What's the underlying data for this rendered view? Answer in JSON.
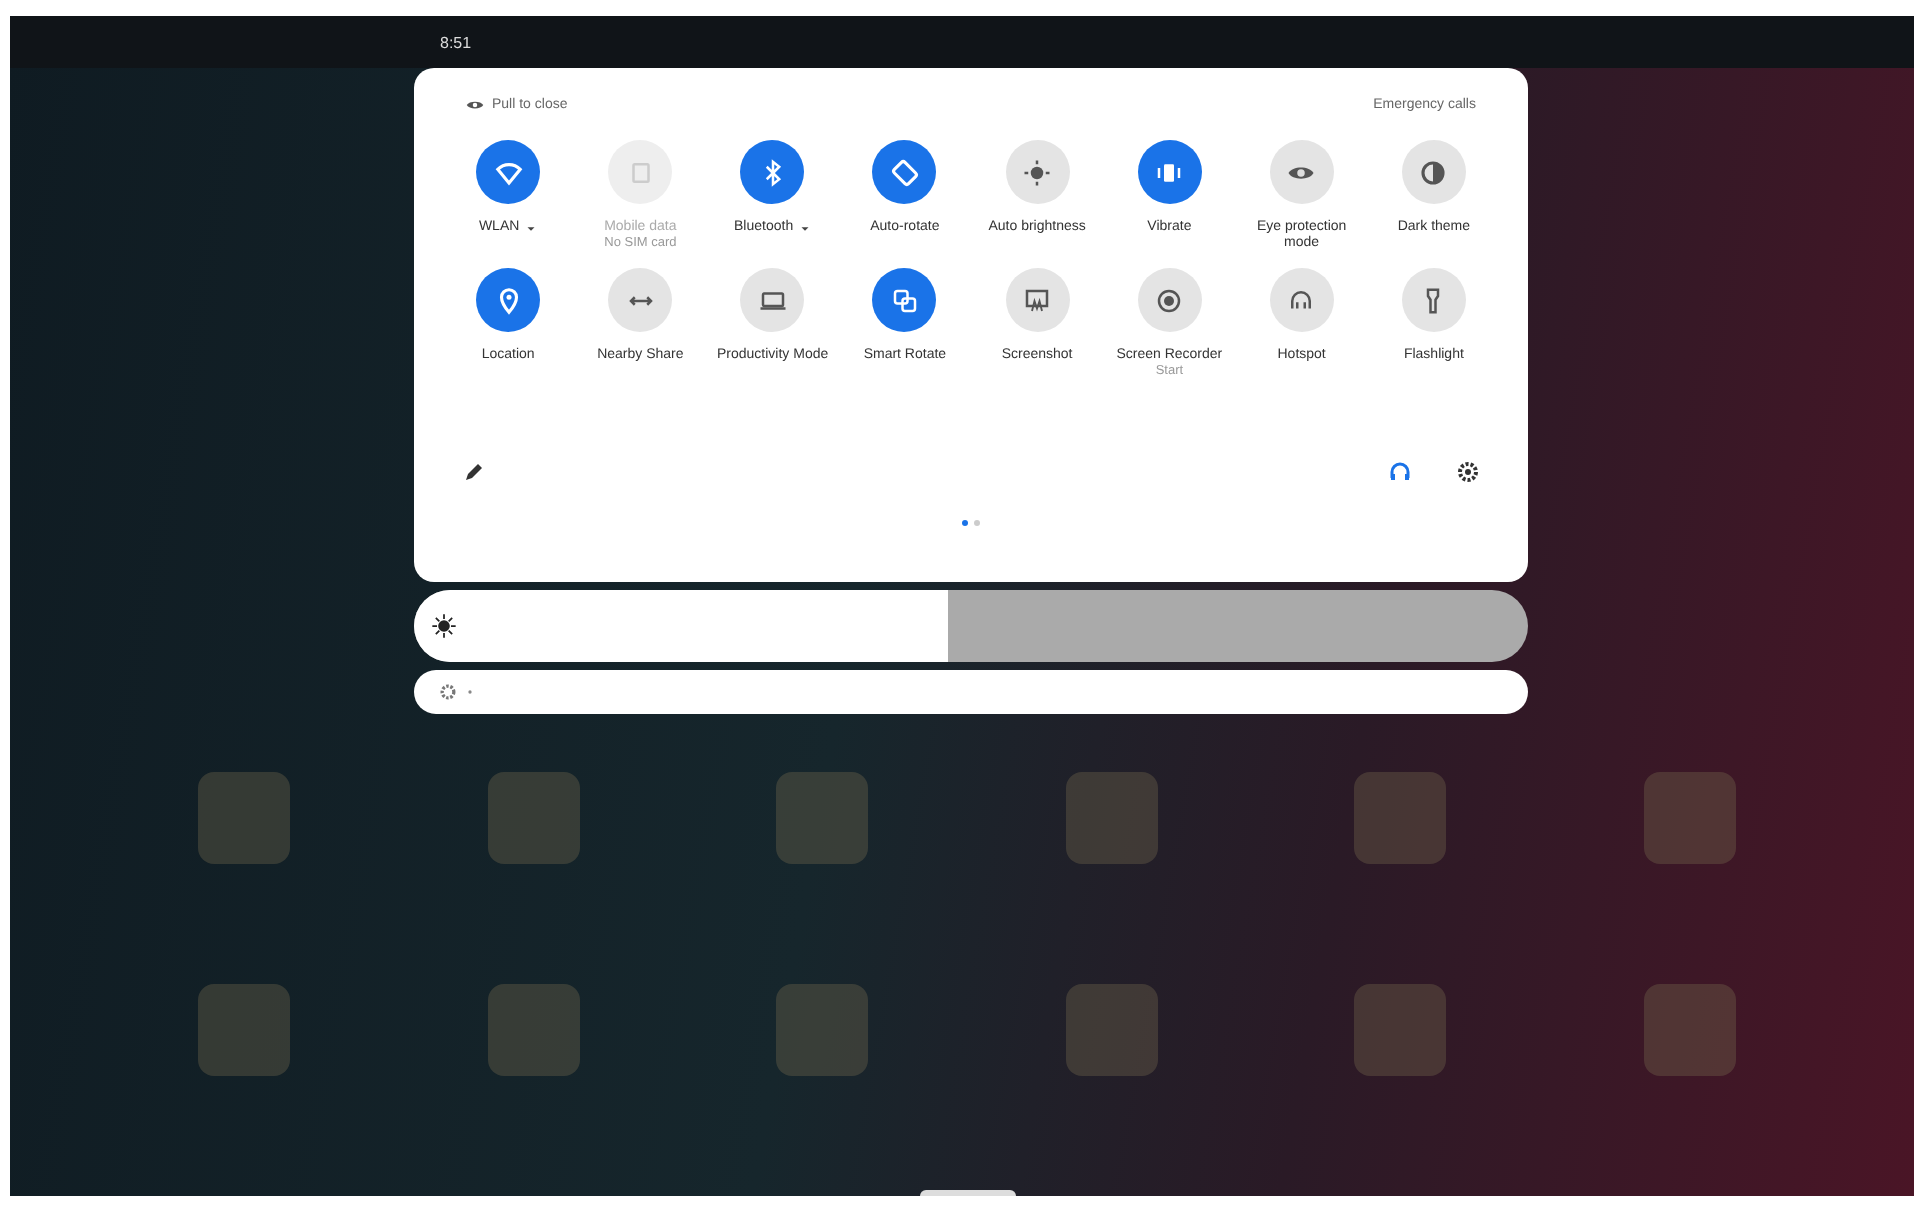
{
  "status_bar": {
    "time": "8:51"
  },
  "panel": {
    "header_left": "Pull to close",
    "header_right": "Emergency calls",
    "tiles": [
      {
        "kind": "toggle",
        "label": "WLAN",
        "caret": true,
        "on": true,
        "disabled": false
      },
      {
        "kind": "toggle",
        "label": "Mobile data",
        "sublabel": "No SIM card",
        "on": false,
        "disabled": true
      },
      {
        "kind": "toggle",
        "label": "Bluetooth",
        "caret": true,
        "on": true,
        "disabled": false
      },
      {
        "kind": "toggle",
        "label": "Auto-rotate",
        "on": true,
        "disabled": false
      },
      {
        "kind": "toggle",
        "label": "Auto brightness",
        "on": false,
        "disabled": false
      },
      {
        "kind": "toggle",
        "label": "Vibrate",
        "on": true,
        "disabled": false
      },
      {
        "kind": "toggle",
        "label": "Eye protection mode",
        "on": false,
        "disabled": false
      },
      {
        "kind": "toggle",
        "label": "Dark theme",
        "on": false,
        "disabled": false
      },
      {
        "kind": "toggle",
        "label": "Location",
        "on": true,
        "disabled": false
      },
      {
        "kind": "toggle",
        "label": "Nearby Share",
        "on": false,
        "disabled": false
      },
      {
        "kind": "toggle",
        "label": "Productivity Mode",
        "on": false,
        "disabled": false
      },
      {
        "kind": "toggle",
        "label": "Smart Rotate",
        "on": true,
        "disabled": false
      },
      {
        "kind": "toggle",
        "label": "Screenshot",
        "on": false,
        "disabled": false
      },
      {
        "kind": "toggle",
        "label": "Screen Recorder",
        "sublabel": "Start",
        "on": false,
        "disabled": false
      },
      {
        "kind": "toggle",
        "label": "Hotspot",
        "on": false,
        "disabled": false
      },
      {
        "kind": "toggle",
        "label": "Flashlight",
        "on": false,
        "disabled": false
      }
    ],
    "pages": [
      {
        "selected": true
      },
      {
        "selected": false
      }
    ]
  },
  "brightness": {
    "level": 0.48
  }
}
